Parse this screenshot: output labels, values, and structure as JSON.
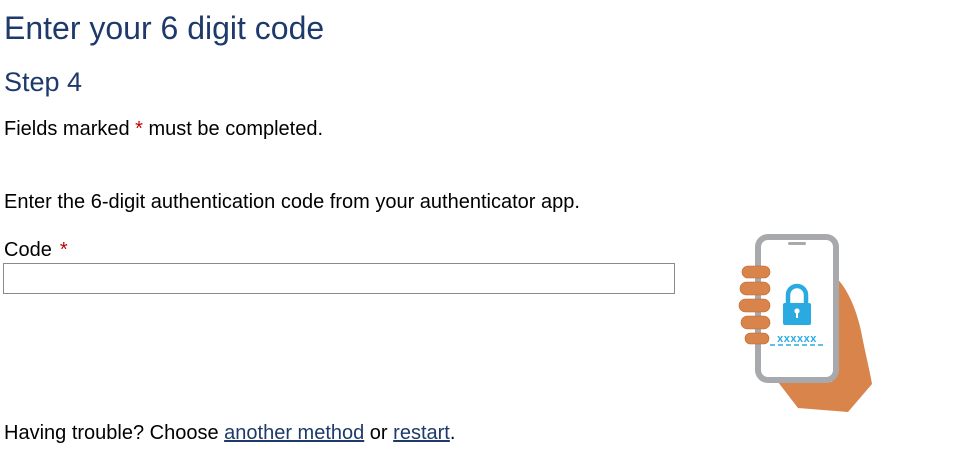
{
  "page": {
    "title": "Enter your 6 digit code",
    "step": "Step 4"
  },
  "required_note": {
    "before": "Fields marked ",
    "marker": "*",
    "after": " must be completed."
  },
  "instructions": "Enter the 6-digit authentication code from your authenticator app.",
  "code_field": {
    "label": "Code",
    "required_marker": "*",
    "value": "",
    "placeholder": ""
  },
  "trouble": {
    "prefix": "Having trouble? Choose ",
    "link_another_method": "another method",
    "middle": " or ",
    "link_restart": "restart",
    "suffix": "."
  },
  "illustration": {
    "icon": "phone-authenticator-icon",
    "masked_code": "xxxxxx",
    "colors": {
      "phone_frame": "#a7a9ac",
      "lock": "#29abe2",
      "hand": "#d8844b",
      "screen": "#ffffff"
    }
  },
  "colors": {
    "heading": "#1d3a6a",
    "required": "#c00000",
    "link": "#1d3a6a"
  }
}
